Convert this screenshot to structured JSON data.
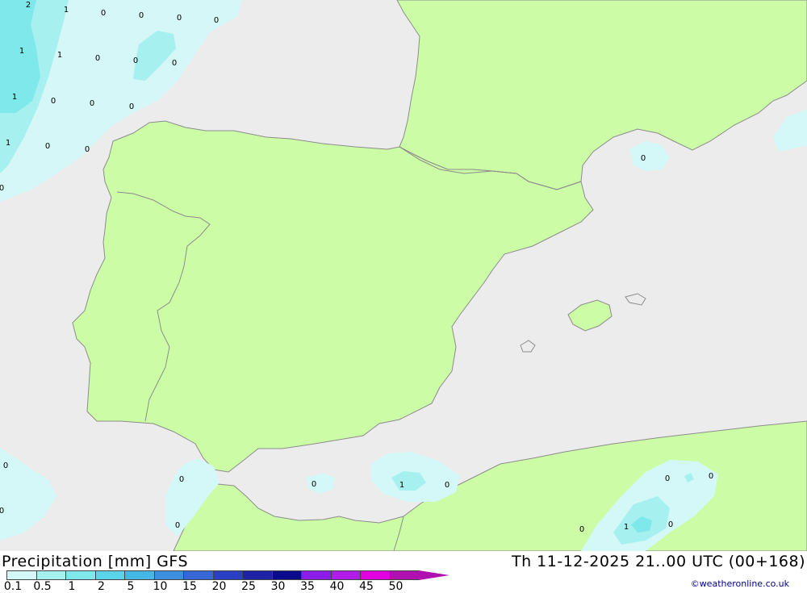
{
  "title": {
    "left": "Precipitation [mm] GFS",
    "right": "Th 11-12-2025 21..00 UTC (00+168)"
  },
  "credit": "©weatheronline.co.uk",
  "legend": {
    "labels": [
      "0.1",
      "0.5",
      "1",
      "2",
      "5",
      "10",
      "15",
      "20",
      "25",
      "30",
      "35",
      "40",
      "45",
      "50"
    ],
    "colors": [
      "#d4f8f8",
      "#a6f0f0",
      "#7ee8ea",
      "#5ad4e6",
      "#45b7e4",
      "#3c8ede",
      "#3766d6",
      "#2a3fc2",
      "#1e22a4",
      "#0a0a8c",
      "#8c1ce8",
      "#b21ce8",
      "#e000e0",
      "#b010b0"
    ]
  },
  "colors": {
    "sea": "#ececec",
    "land": "#ccfca6",
    "border": "#8c8c8c",
    "precip_light": "#d4f8f8",
    "precip_mid": "#a6f0f0",
    "precip_heavy": "#7ee8ea"
  },
  "map_values": [
    "2",
    "1",
    "0",
    "0",
    "0",
    "0",
    "1",
    "1",
    "0",
    "0",
    "0",
    "1",
    "0",
    "0",
    "0",
    "1",
    "0",
    "0",
    "0",
    "0",
    "0",
    "0",
    "0",
    "0",
    "1",
    "0",
    "0",
    "0",
    "1",
    "0",
    "0",
    "0"
  ]
}
